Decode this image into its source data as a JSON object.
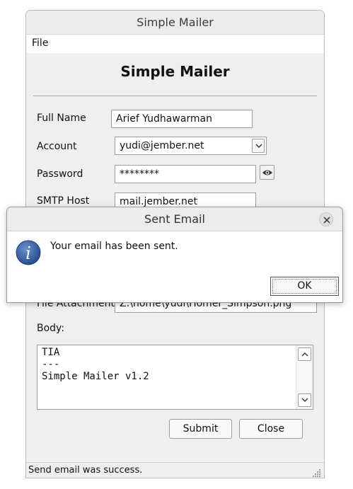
{
  "window": {
    "title": "Simple Mailer",
    "menu": {
      "file": "File"
    }
  },
  "form": {
    "heading": "Simple Mailer",
    "full_name": {
      "label": "Full Name",
      "value": "Arief Yudhawarman"
    },
    "account": {
      "label": "Account",
      "value": "yudi@jember.net"
    },
    "password": {
      "label": "Password",
      "value": "********"
    },
    "smtp_host": {
      "label": "SMTP Host",
      "value": "mail.jember.net"
    },
    "file_attachment": {
      "label": "File Attachment",
      "value": "Z:\\home\\yudi\\Homer_Simpson.png"
    },
    "body": {
      "label": "Body:",
      "value": "TIA\n---\nSimple Mailer v1.2"
    },
    "submit_label": "Submit",
    "close_label": "Close"
  },
  "status": {
    "text": "Send email was success."
  },
  "dialog": {
    "title": "Sent Email",
    "message": "Your email has been sent.",
    "ok_label": "OK",
    "icon": "info-icon"
  },
  "colors": {
    "info_icon": "#2f5d9e"
  }
}
